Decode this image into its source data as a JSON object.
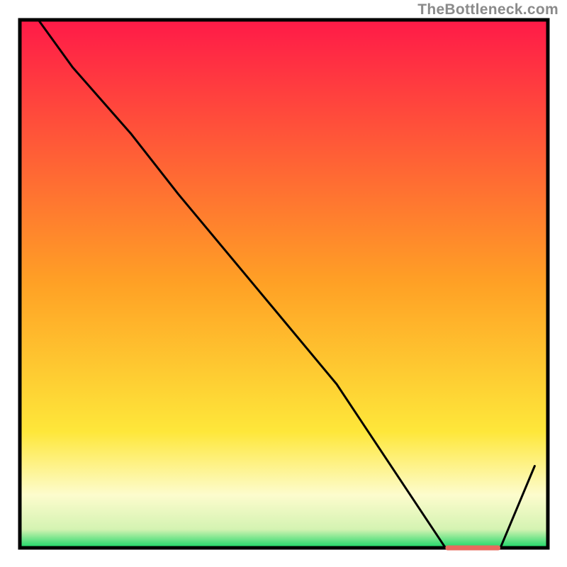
{
  "watermark": "TheBottleneck.com",
  "chart_data": {
    "type": "line",
    "title": "",
    "xlabel": "",
    "ylabel": "",
    "xlim": [
      0,
      100
    ],
    "ylim": [
      0,
      100
    ],
    "series": [
      {
        "name": "curve",
        "x": [
          3.5,
          10,
          21,
          30,
          45,
          60,
          80.6,
          86,
          91,
          97.5
        ],
        "values": [
          100,
          91,
          78.5,
          67,
          49,
          31,
          0,
          0,
          0,
          15.5
        ]
      }
    ],
    "marker": {
      "name": "highlight-segment",
      "x_start": 80.6,
      "x_end": 91,
      "y": 0,
      "color": "#e86a5e"
    },
    "background": {
      "type": "vertical-gradient",
      "stops": [
        {
          "pos": 0.0,
          "color": "#ff1a48"
        },
        {
          "pos": 0.5,
          "color": "#ffa125"
        },
        {
          "pos": 0.78,
          "color": "#fee73a"
        },
        {
          "pos": 0.9,
          "color": "#fdfccd"
        },
        {
          "pos": 0.965,
          "color": "#d4f3b2"
        },
        {
          "pos": 1.0,
          "color": "#17d766"
        }
      ]
    }
  }
}
